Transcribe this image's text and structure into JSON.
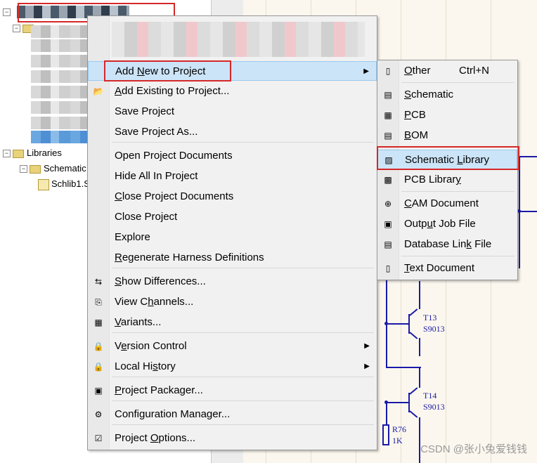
{
  "tree": {
    "libraries_label": "Libraries",
    "schematic_label": "Schematic",
    "schlib_label": "Schlib1.S"
  },
  "context_menu": {
    "items": [
      {
        "pre": "Add ",
        "u": "N",
        "post": "ew to Project",
        "submenu": true
      },
      {
        "pre": "",
        "u": "A",
        "post": "dd Existing to Project..."
      },
      {
        "pre": "Save Project",
        "u": "",
        "post": ""
      },
      {
        "pre": "Save Project As...",
        "u": "",
        "post": ""
      },
      {
        "pre": "Open Project Documents",
        "u": "",
        "post": ""
      },
      {
        "pre": "Hide All In Project",
        "u": "",
        "post": ""
      },
      {
        "pre": "",
        "u": "C",
        "post": "lose Project Documents"
      },
      {
        "pre": "Close Project",
        "u": "",
        "post": ""
      },
      {
        "pre": "Explore",
        "u": "",
        "post": ""
      },
      {
        "pre": "",
        "u": "R",
        "post": "egenerate Harness Definitions"
      },
      {
        "pre": "",
        "u": "S",
        "post": "how Differences..."
      },
      {
        "pre": "View C",
        "u": "h",
        "post": "annels..."
      },
      {
        "pre": "",
        "u": "V",
        "post": "ariants..."
      },
      {
        "pre": "V",
        "u": "e",
        "post": "rsion Control",
        "submenu": true
      },
      {
        "pre": "Local Hi",
        "u": "s",
        "post": "tory",
        "submenu": true
      },
      {
        "pre": "",
        "u": "P",
        "post": "roject Packager..."
      },
      {
        "pre": "Configuration Manager...",
        "u": "",
        "post": ""
      },
      {
        "pre": "Project ",
        "u": "O",
        "post": "ptions..."
      }
    ]
  },
  "submenu": {
    "items": [
      {
        "pre": "",
        "u": "O",
        "post": "ther",
        "accel": "Ctrl+N"
      },
      {
        "pre": "",
        "u": "S",
        "post": "chematic"
      },
      {
        "pre": "",
        "u": "P",
        "post": "CB"
      },
      {
        "pre": "",
        "u": "B",
        "post": "OM"
      },
      {
        "pre": "Schematic ",
        "u": "L",
        "post": "ibrary"
      },
      {
        "pre": "PCB Librar",
        "u": "y",
        "post": ""
      },
      {
        "pre": "",
        "u": "C",
        "post": "AM Document"
      },
      {
        "pre": "Outp",
        "u": "u",
        "post": "t Job File"
      },
      {
        "pre": "Database Lin",
        "u": "k",
        "post": " File"
      },
      {
        "pre": "",
        "u": "T",
        "post": "ext Document"
      }
    ]
  },
  "schematic": {
    "t13_ref": "T13",
    "t13_part": "S9013",
    "t14_ref": "T14",
    "t14_part": "S9013",
    "r76_ref": "R76",
    "r76_value": "1K"
  },
  "watermark": "CSDN @张小兔爱钱钱",
  "colors": {
    "menu_bg": "#f1f1f1",
    "highlight": "#cce4f7",
    "annotation_red": "#d62828",
    "wire_blue": "#1a1aa8"
  }
}
